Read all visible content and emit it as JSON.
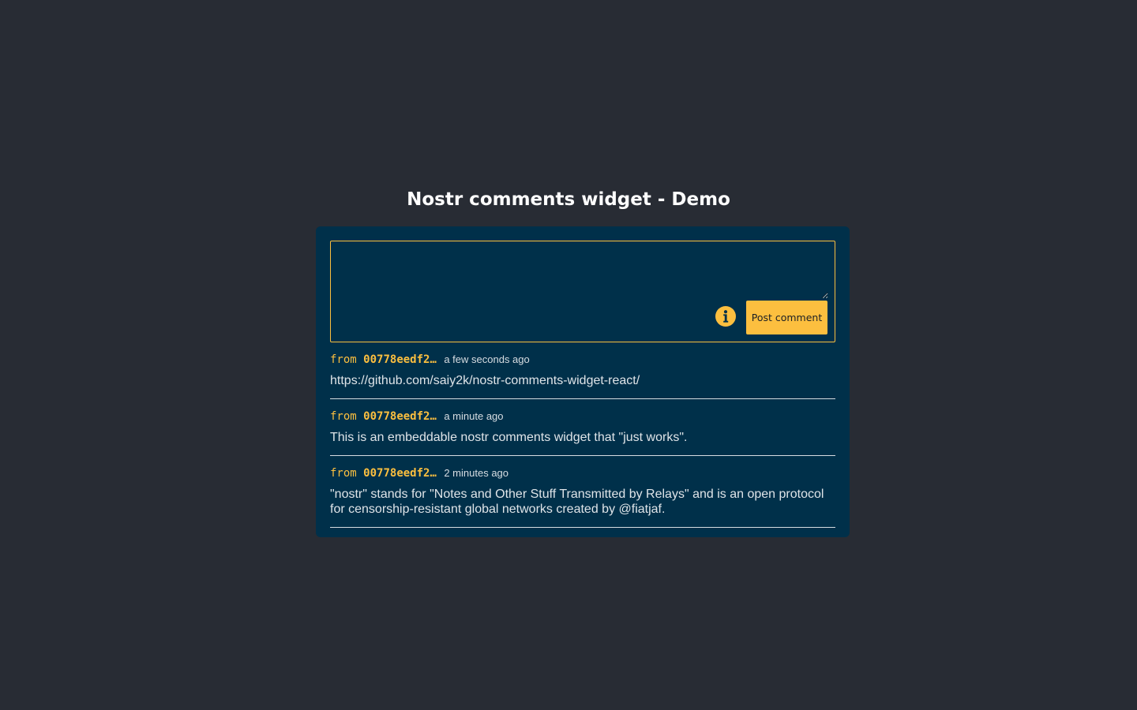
{
  "page": {
    "title": "Nostr comments widget - Demo"
  },
  "composer": {
    "placeholder": "",
    "value": "",
    "info_icon": "info-icon",
    "post_label": "Post comment"
  },
  "comments": [
    {
      "from_label": "from",
      "author": "00778eedf2…",
      "time": "a few seconds ago",
      "text": "https://github.com/saiy2k/nostr-comments-widget-react/"
    },
    {
      "from_label": "from",
      "author": "00778eedf2…",
      "time": "a minute ago",
      "text": "This is an embeddable nostr comments widget that \"just works\"."
    },
    {
      "from_label": "from",
      "author": "00778eedf2…",
      "time": "2 minutes ago",
      "text": "\"nostr\" stands for \"Notes and Other Stuff Transmitted by Relays\" and is an open protocol for censorship-resistant global networks created by @fiatjaf."
    }
  ],
  "colors": {
    "background": "#282c34",
    "widget": "#00304a",
    "accent": "#fcbf3f",
    "text": "#dfe4e8",
    "title": "#ffffff"
  }
}
